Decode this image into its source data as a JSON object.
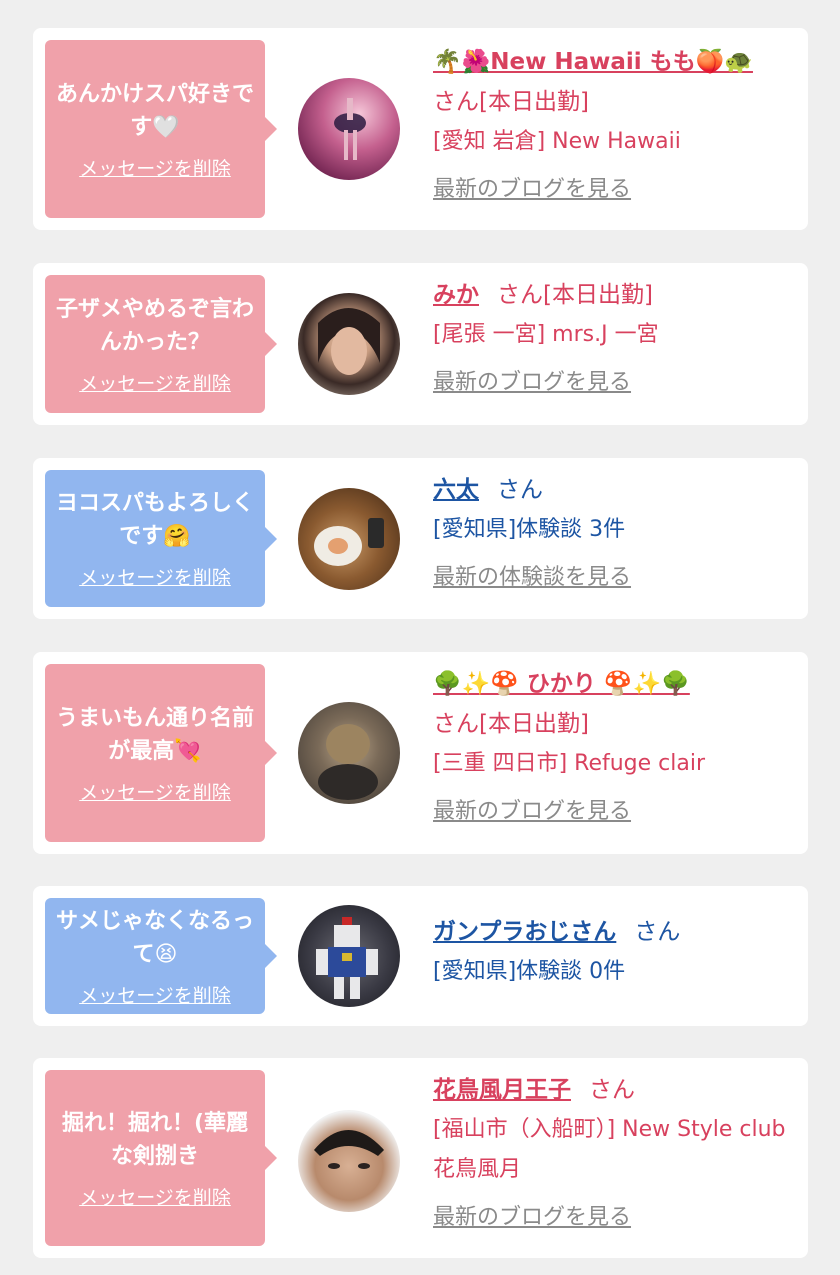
{
  "colors": {
    "pink": "#f0a1aa",
    "blue": "#91b6ef",
    "red_text": "#d8415e",
    "blue_text": "#1d55a3",
    "link_gray": "#8a8a8a"
  },
  "cards": [
    {
      "message": "あんかけスパ好きです🤍",
      "delete_label": "メッセージを削除",
      "name": "🌴🌺New Hawaii もも🍑🐢",
      "suffix": "さん[本日出勤]",
      "shop": "[愛知 岩倉] New Hawaii",
      "link": "最新のブログを見る"
    },
    {
      "message": "子ザメやめるぞ言わんかった？",
      "delete_label": "メッセージを削除",
      "name": "みか",
      "suffix": "さん[本日出勤]",
      "shop": "[尾張 一宮] mrs.J 一宮",
      "link": "最新のブログを見る"
    },
    {
      "message": "ヨコスパもよろしくです🤗",
      "delete_label": "メッセージを削除",
      "name": "六太",
      "suffix": "さん",
      "shop": "[愛知県]体験談 3件",
      "link": "最新の体験談を見る"
    },
    {
      "message": "うまいもん通り名前が最高💘",
      "delete_label": "メッセージを削除",
      "name": "🌳✨🍄 ひかり 🍄✨🌳",
      "suffix": "さん[本日出勤]",
      "shop": "[三重 四日市] Refuge clair",
      "link": "最新のブログを見る"
    },
    {
      "message": "サメじゃなくなるって😫",
      "delete_label": "メッセージを削除",
      "name": "ガンプラおじさん",
      "suffix": "さん",
      "shop": "[愛知県]体験談 0件",
      "link": ""
    },
    {
      "message": "掘れ！掘れ！(華麗な剣捌き",
      "delete_label": "メッセージを削除",
      "name": "花鳥風月王子",
      "suffix": "さん",
      "shop": "[福山市（入船町）] New Style club花鳥風月",
      "link": "最新のブログを見る"
    }
  ]
}
